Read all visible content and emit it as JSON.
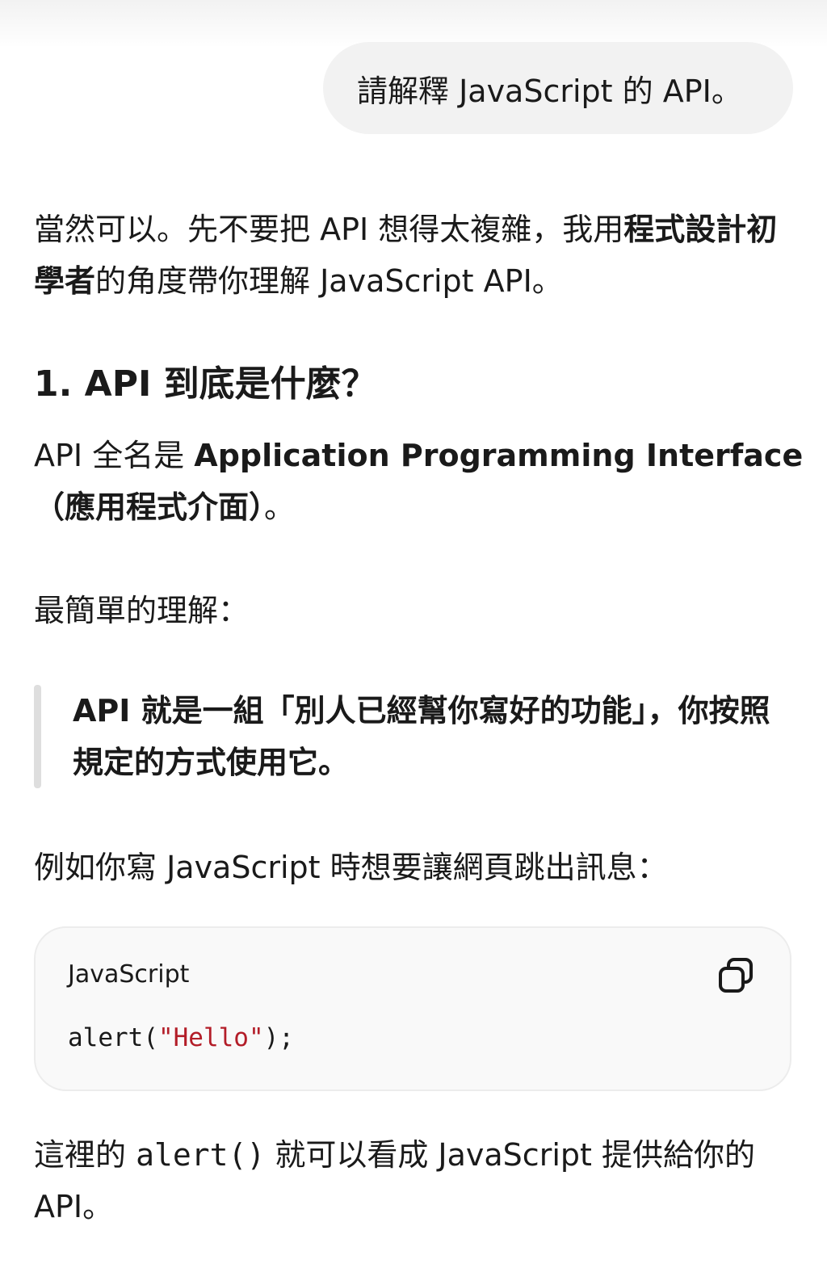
{
  "user_message": "請解釋 JavaScript 的 API。",
  "intro": {
    "part1": "當然可以。先不要把 API 想得太複雜，我用",
    "bold": "程式設計初學者",
    "part2": "的角度帶你理解 JavaScript API。"
  },
  "heading": "1. API 到底是什麼？",
  "definition": {
    "part1": "API 全名是 ",
    "bold1": "Application Programming Interface",
    "bold2": "（應用程式介面）",
    "part2": "。"
  },
  "simple_label": "最簡單的理解：",
  "blockquote": "API 就是一組「別人已經幫你寫好的功能」，你按照規定的方式使用它。",
  "example_intro": "例如你寫 JavaScript 時想要讓網頁跳出訊息：",
  "code_block": {
    "language": "JavaScript",
    "code_pre": "alert(",
    "code_string": "\"Hello\"",
    "code_post": ");",
    "copy_icon": "copy-icon"
  },
  "after_code": {
    "part1": "這裡的 ",
    "code": "alert()",
    "part2": " 就可以看成 JavaScript 提供給你的 API。"
  }
}
